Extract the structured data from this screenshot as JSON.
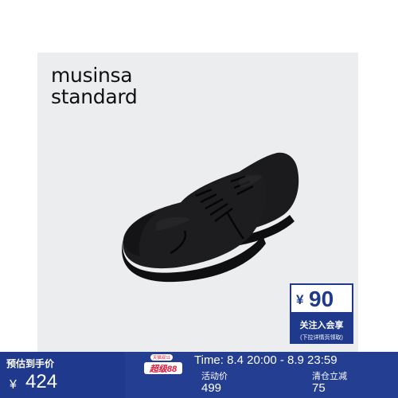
{
  "brand": {
    "line1": "musinsa",
    "line2": "standard"
  },
  "product_image": {
    "icon": "black-sneakers-pair"
  },
  "coupon": {
    "currency": "¥",
    "amount": "90",
    "line1": "关注入会享",
    "line2": "(下拉详情页领取)"
  },
  "price_bar": {
    "presale_label": "预估到手价",
    "currency": "¥",
    "price": "424",
    "badge_small": "天猫双11",
    "badge_main": "超级88",
    "time": "Time: 8.4 20:00 - 8.9 23:59",
    "activity_label": "活动价",
    "activity_price": "499",
    "clearance_label": "清仓立减",
    "clearance_amount": "75"
  },
  "colors": {
    "navy": "#1f3a8c",
    "background": "#ecedef"
  }
}
